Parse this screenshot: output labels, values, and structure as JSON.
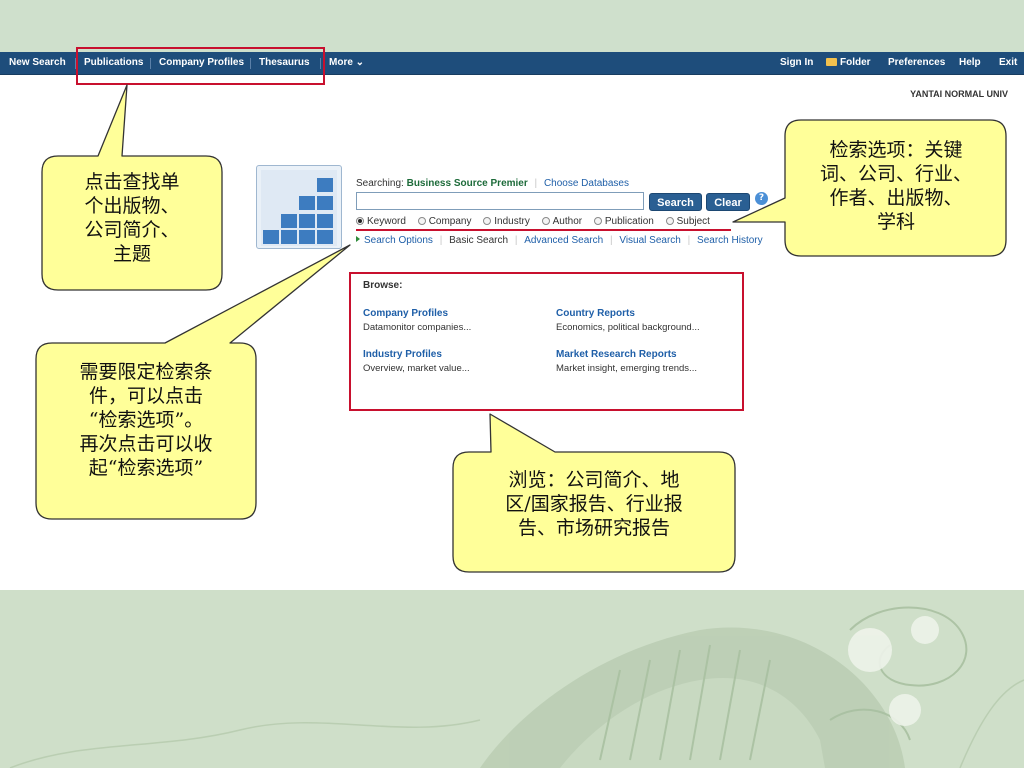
{
  "navbar": {
    "left_items": [
      "New Search",
      "Publications",
      "Company Profiles",
      "Thesaurus",
      "More ⌄"
    ],
    "right_items": [
      "Sign In",
      "Folder",
      "Preferences",
      "Help",
      "Exit"
    ]
  },
  "institution": "YANTAI NORMAL UNIV",
  "search": {
    "searching_label": "Searching:",
    "database": "Business Source Premier",
    "choose_databases": "Choose Databases",
    "input_value": "",
    "search_button": "Search",
    "clear_button": "Clear",
    "help_icon": "?",
    "radio_options": [
      "Keyword",
      "Company",
      "Industry",
      "Author",
      "Publication",
      "Subject"
    ],
    "selected_radio": "Keyword",
    "links": [
      "Search Options",
      "Basic Search",
      "Advanced Search",
      "Visual Search",
      "Search History"
    ]
  },
  "browse": {
    "title": "Browse:",
    "items": [
      {
        "title": "Company Profiles",
        "desc": "Datamonitor companies..."
      },
      {
        "title": "Country Reports",
        "desc": "Economics, political background..."
      },
      {
        "title": "Industry Profiles",
        "desc": "Overview, market value..."
      },
      {
        "title": "Market Research Reports",
        "desc": "Market insight, emerging trends..."
      }
    ]
  },
  "callouts": {
    "nav_note": [
      "点击查找单",
      "个出版物、",
      "公司简介、",
      "主题"
    ],
    "options_note": [
      "检索选项：关键",
      "词、公司、行业、",
      "作者、出版物、",
      "学科"
    ],
    "search_options_note": [
      "需要限定检索条",
      "件，可以点击",
      "“检索选项”。",
      "再次点击可以收",
      "起“检索选项”"
    ],
    "browse_note": [
      "浏览：公司简介、地",
      "区/国家报告、行业报",
      "告、市场研究报告"
    ]
  },
  "colors": {
    "navbar_bg": "#1e4d7b",
    "highlight_red": "#c8102e",
    "callout_fill": "#ffff99",
    "slide_band": "#cfe0cc",
    "link_blue": "#1f5fa8",
    "button_blue": "#2a5f93"
  }
}
